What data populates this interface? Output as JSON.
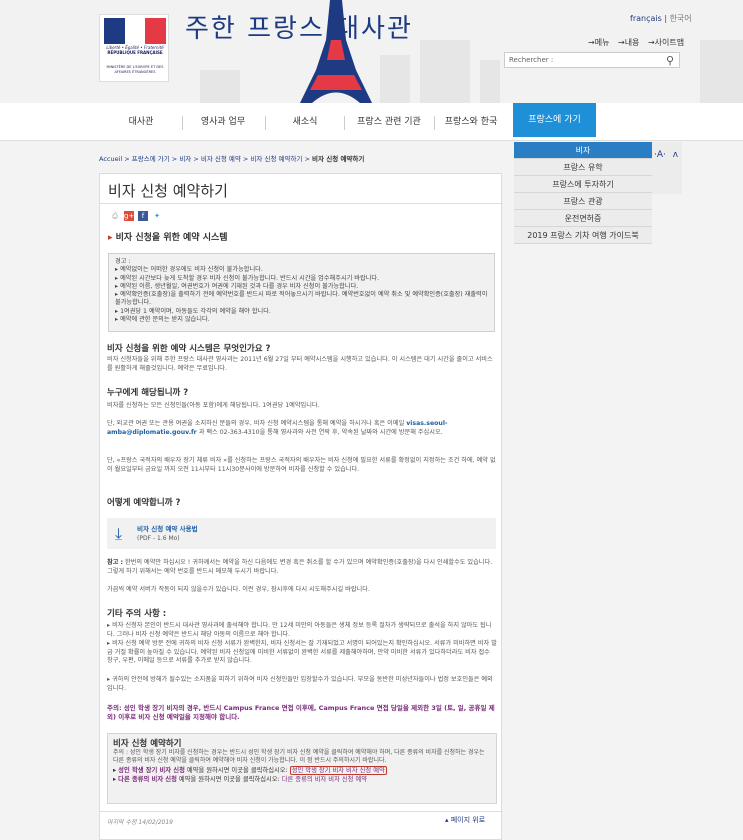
{
  "header": {
    "site_title": "주한 프랑스 대사관",
    "logo_line1": "Liberté • Égalité • Fraternité",
    "logo_line2": "RÉPUBLIQUE FRANÇAISE",
    "logo_line3": "MINISTÈRE DE L'EUROPE ET DES AFFAIRES ÉTRANGÈRES",
    "lang_fr": "français",
    "lang_ko": "한국어",
    "util_menu": "→메뉴",
    "util_content": "→내용",
    "util_sitemap": "→사이트맵",
    "search_placeholder": "Rechercher :"
  },
  "nav": {
    "items": [
      "대사관",
      "영사과 업무",
      "새소식",
      "프랑스 관련 기관",
      "프랑스와 한국",
      "프랑스에 가기"
    ]
  },
  "dropdown": {
    "items": [
      "비자",
      "프랑스 유학",
      "프랑스에 투자하기",
      "프랑스 관광",
      "운전면허증",
      "2019 프랑스 기차 여행 가이드북"
    ]
  },
  "breadcrumb": {
    "path": "Accueil > 프랑스에 가기 > 비자 > 비자 신청 예약 > 비자 신청 예약하기 > ",
    "current": "비자 신청 예약하기"
  },
  "page": {
    "title": "비자 신청 예약하기",
    "section1": "비자 신청을 위한 예약 시스템",
    "warn_title": "경고 :",
    "warnings": [
      "▸ 예약없이는 어떠한 경우에도 비자 신청이 불가능합니다.",
      "▸ 예약된 시간보다 늦게 도착할 경우 비자 신청이 불가능합니다. 반드시 시간을 엄수해주시기 바랍니다.",
      "▸ 예약된 이름, 생년월일, 여권번호가 여권에 기재된 것과 다를 경우 비자 신청이 불가능합니다.",
      "▸ 예약확인증(호출장)을 출력하기 전에 예약번호를 반드시 따로 적어놓으시기 바랍니다. 예약번호없이 예약 취소 및 예약확인증(호출장) 재출력이 불가능합니다.",
      "▸ 1여권당 1 예약이며, 아동들도 각각의 예약을 해야 합니다.",
      "▸ 예약에 관한 문의는 받지 않습니다."
    ],
    "h_what": "비자 신청을 위한 예약 시스템은 무엇인가요 ?",
    "p_what": "비자 신청자들을 위해 주한 프랑스 대사관 영사과는 2011년 6월 27일 부터 예약시스템을 시행하고 있습니다. 이 시스템은 대기 시간을 줄이고 서비스를 원활하게 해줄것입니다. 예약은 무료입니다.",
    "h_who": "누구에게 해당됩니까 ?",
    "p_who1": "비자를 신청하는 모든 신청인들(아동 포함)에게 해당됩니다. 1여권당 1예약입니다.",
    "p_who2a": "단, 외교관 여권 또는 관용 여권을 소지하신 분들의 경우, 비자 신청 예약시스템을 통해 예약을 하시거나 혹은 이메일 ",
    "p_who2_email": "visas.seoul-amba@diplomatie.gouv.fr",
    "p_who2b": " 과 팩스 02-363-4310을 통해 영사과와 사전 연락 후, 약속된 날짜와 시간에 방문해 주십시오.",
    "p_who3": "단, «프랑스 국적자의 배우자 장기 체류 비자 »를 신청하는 프랑스 국적자의 배우자는 비자 신청에 필요한 서류를 확정없이 지정하는 조건 하에, 예약 없이 월요일부터 금요일 까지 오전 11시부터 11시30분사이에 방문하여 비자를 신청할 수 있습니다.",
    "h_how": "어떻게 예약합니까 ?",
    "dl_title": "비자 신청 예약 사용법",
    "dl_sub": "(PDF - 1.6 Mo)",
    "p_note_label": "참고 :",
    "p_note": " 한번의 예약만 하십시오 ! 귀하께서는 예약을 하신 다음에도 변경 혹은 취소를 할 수가 있으며 예약확인증(호출장)을 다시 인쇄할수도 있습니다. 그렇게 하기 위해서는 예약 번호를 반드시 메모해 두시기 바랍니다.",
    "p_note2": "가끔씩 예약 서버가 작동이 되지 않을수가 있습니다. 이런 경우, 잠시후에 다시 시도해주시길 바랍니다.",
    "h_other": "기타 주의 사항 :",
    "p_other1": "▸ 비자 신청자 본인이 반드시 대사관 영사과에 출석해야 합니다. 만 12세 미만의 아동들은 생체 정보 등록 절차가 생략되므로 출석을 하지 않아도 됩니다. 그러나 비자 신청 예약은 반드시 해당 아동의 이름으로 해야 합니다.",
    "p_other2": "▸ 비자 신청 예약 방문 전에 귀하의 비자 신청 서류가 완벽한지, 비자 신청서는 잘 기재되었고 서명이 되어있는지 확인하십시오. 서류가 미비하면 비자 발급 거절 확률이 높아질 수 있습니다. 예약된 비자 신청일에 미비한 서류없이 완벽한 서류를 제출해야하며, 만약 미비한 서류가 있다하더라도 비자 접수 창구, 우편, 이메일 등으로 서류를 추가로 받지 않습니다.",
    "p_other3": "▸ 귀하의 안전에 방해가 될수있는 소지품을 피하기 위하여 비자 신청인들만 입장할수가 있습니다. 부모을 동반한 미성년자들이나 법정 보호인들은 예외입니다.",
    "purple_note": "주의: 성인 학생 장기 비자의 경우, 반드시 Campus France 면접 이후에, Campus France 면접 당일을 제외한 3일 (토, 일, 공휴일 제외) 이후로 비자 신청 예약일을 지정해야 합니다.",
    "apply_title": "비자 신청 예약하기",
    "apply_p": "주의 : 성인 학생 장기 비자를 신청하는 경우는 반드시 성인 학생 장기 비자 신청 예약을 클릭하여 예약해야 하며, 다른 종류의 비자를 신청하는 경우는 다른 종류의 비자 신청 예약을 클릭하여 예약해야 비자 신청이 가능합니다. 이 점 반드시 주의하시기 바랍니다.",
    "apply_l1_b": "성인 학생 장기 비자 신청",
    "apply_l1_t": " 예약을 원하시면 이곳을 클릭하십시오: ",
    "apply_l1_link": "성인 학생 장기 비자 비자 신청 예약",
    "apply_l2_b": "다른 종류의 비자 신청",
    "apply_l2_t": " 예약을 원하시면 이곳을 클릭하십시오: ",
    "apply_l2_link": "다른 종류의 비자 비자 신청 예약",
    "modified": "마지막 수정 14/02/2019",
    "top_link": "▴ 페이지 위로"
  }
}
